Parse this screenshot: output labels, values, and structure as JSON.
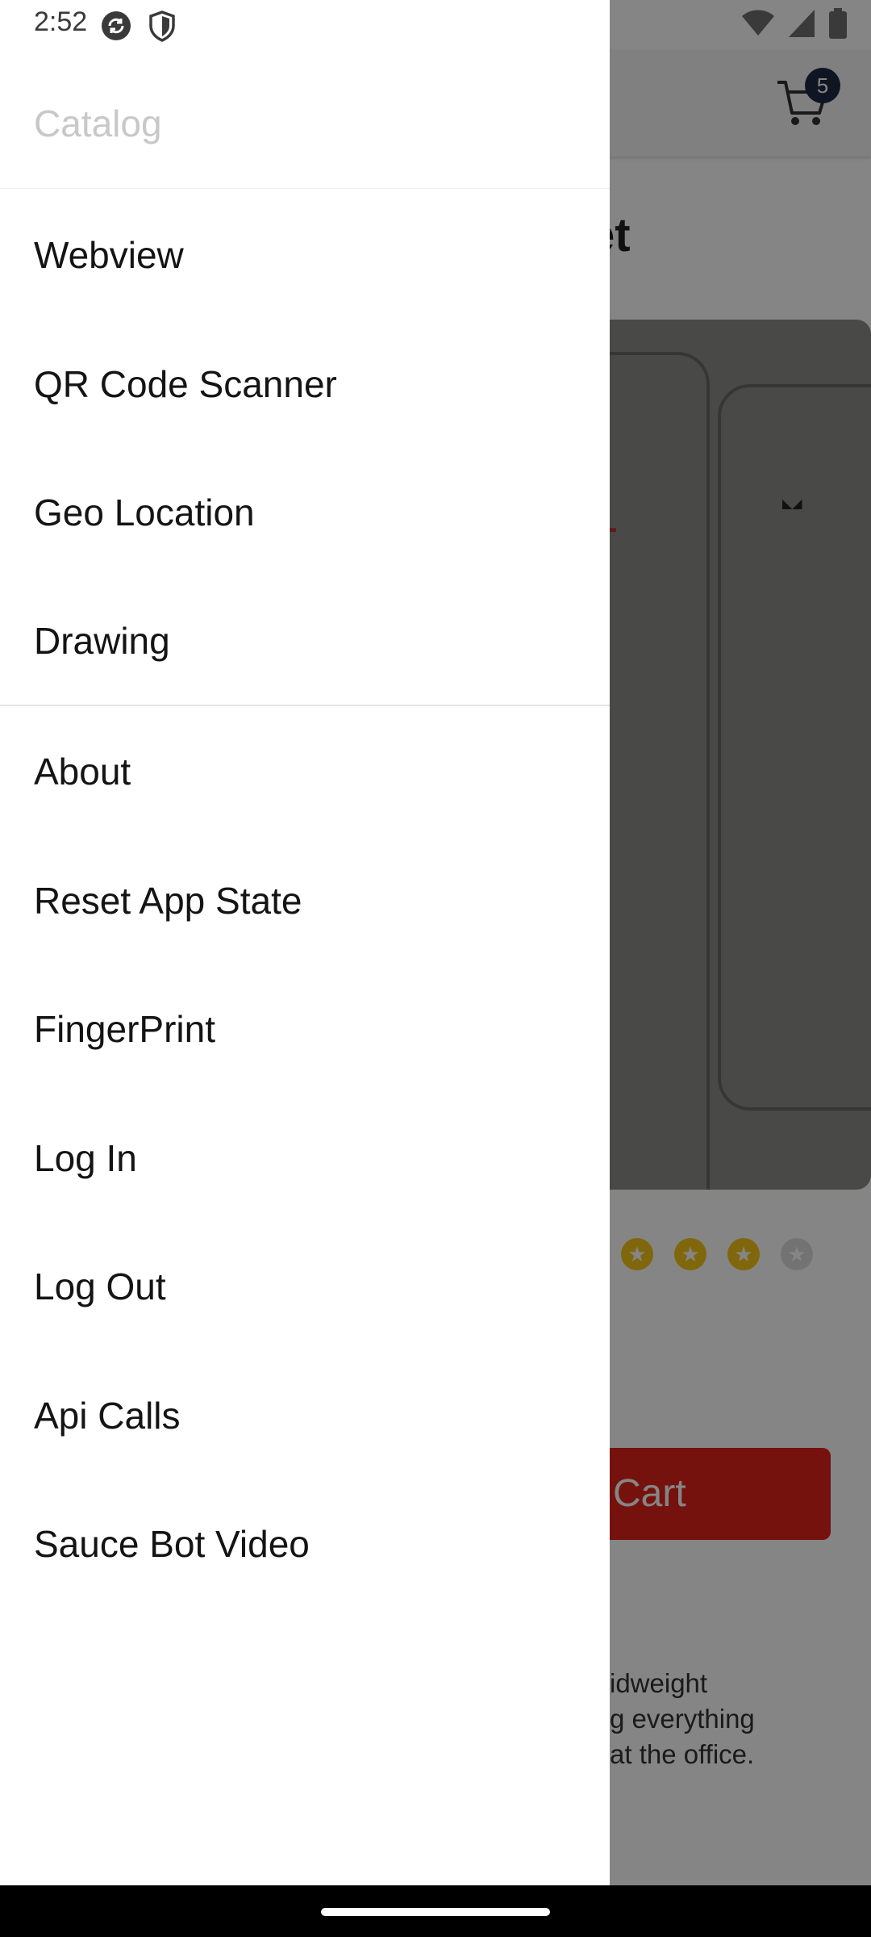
{
  "status_bar": {
    "time": "2:52",
    "icons": [
      "sync-icon",
      "shield-icon",
      "wifi-icon",
      "signal-icon",
      "battery-icon"
    ]
  },
  "background": {
    "cart_count": "5",
    "title_fragment": "et",
    "button_fragment": "Cart",
    "description_lines": [
      "idweight",
      "g everything",
      "at the office."
    ],
    "rating": {
      "filled": 3,
      "empty": 1
    },
    "colors": {
      "accent": "#e2231a",
      "star": "#f5c518"
    }
  },
  "drawer": {
    "header_title": "Catalog",
    "items": [
      {
        "label": "Webview"
      },
      {
        "label": "QR Code Scanner"
      },
      {
        "label": "Geo Location"
      },
      {
        "label": "Drawing"
      },
      {
        "label": "About"
      },
      {
        "label": "Reset App State"
      },
      {
        "label": "FingerPrint"
      },
      {
        "label": "Log In"
      },
      {
        "label": "Log Out"
      },
      {
        "label": "Api Calls"
      },
      {
        "label": "Sauce Bot Video"
      }
    ]
  }
}
